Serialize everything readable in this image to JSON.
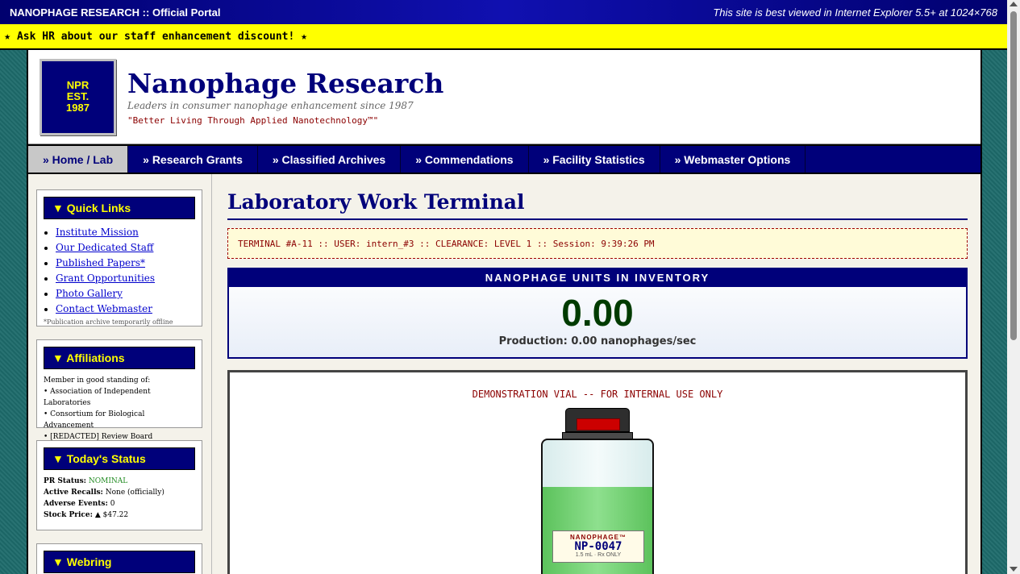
{
  "topbar": {
    "brand": "NANOPHAGE RESEARCH :: Official Portal",
    "notice": "This site is best viewed in Internet Explorer 5.5+ at 1024×768"
  },
  "marquee": {
    "text": "ION ★ Ask HR about our staff enhancement discount! ★"
  },
  "header": {
    "logo_lines": [
      "NPR",
      "EST.",
      "1987"
    ],
    "title": "Nanophage Research",
    "tagline": "Leaders in consumer nanophage enhancement since 1987",
    "motto": "\"Better Living Through Applied Nanotechnology™\""
  },
  "nav": {
    "items": [
      {
        "label": "» Home / Lab",
        "active": true
      },
      {
        "label": "» Research Grants"
      },
      {
        "label": "» Classified Archives"
      },
      {
        "label": "» Commendations"
      },
      {
        "label": "» Facility Statistics"
      },
      {
        "label": "» Webmaster Options"
      }
    ]
  },
  "sidebar": {
    "quick_links": {
      "title": "▼ Quick Links",
      "links": [
        "Institute Mission",
        "Our Dedicated Staff",
        "Published Papers*",
        "Grant Opportunities",
        "Photo Gallery ",
        "Contact Webmaster"
      ],
      "note": "*Publication archive temporarily offline"
    },
    "affiliations": {
      "title": "▼ Affiliations",
      "intro": "Member in good standing of:",
      "items": [
        "• Association of Independent Laboratories",
        "• Consortium for Biological Advancement",
        "• [REDACTED] Review Board"
      ]
    },
    "status": {
      "title": "▼ Today's Status",
      "pr_label": "PR Status:",
      "pr_value": "NOMINAL",
      "recalls_label": "Active Recalls:",
      "recalls_value": "None (officially)",
      "adverse_label": "Adverse Events:",
      "adverse_value": "0",
      "stock_label": "Stock Price:",
      "stock_value": "▲ $47.22",
      "status_color": "#228b22"
    },
    "webring": {
      "title": "▼ Webring"
    }
  },
  "main": {
    "title": "Laboratory Work Terminal",
    "terminal": "TERMINAL #A-11 :: USER: intern_#3 :: CLEARANCE: LEVEL 1 :: Session: 9:39:26 PM",
    "inventory": {
      "heading": "NANOPHAGE UNITS IN INVENTORY",
      "value": "0.00",
      "production": "Production: 0.00 nanophages/sec"
    },
    "vial": {
      "caption": "DEMONSTRATION VIAL -- FOR INTERNAL USE ONLY",
      "label_brand": "NANOPHAGE™",
      "label_code": "NP-0047",
      "label_detail": "1.5 mL · Rx ONLY",
      "liquid_color": "#6acf6a"
    }
  }
}
